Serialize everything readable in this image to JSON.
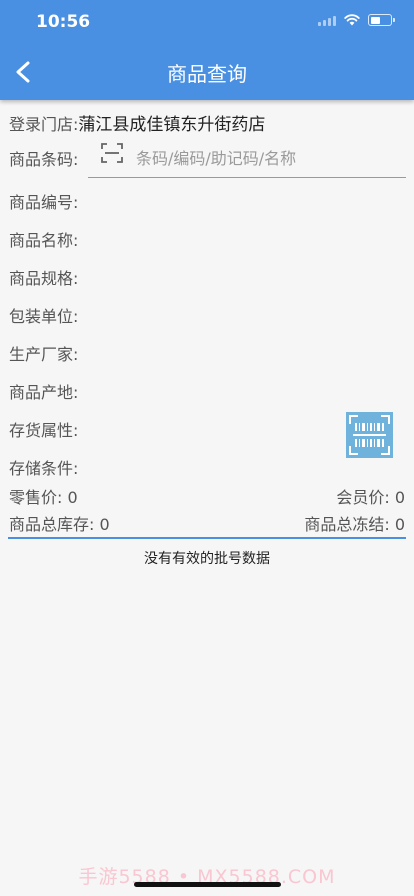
{
  "status_bar": {
    "time": "10:56"
  },
  "header": {
    "title": "商品查询"
  },
  "store": {
    "label": "登录门店:",
    "value": "蒲江县成佳镇东升街药店"
  },
  "search": {
    "label": "商品条码:",
    "placeholder": "条码/编码/助记码/名称",
    "value": ""
  },
  "fields": {
    "code": "商品编号:",
    "name": "商品名称:",
    "spec": "商品规格:",
    "unit": "包装单位:",
    "maker": "生产厂家:",
    "origin": "商品产地:",
    "attr": "存货属性:",
    "storage": "存储条件:"
  },
  "prices": {
    "retail_label": "零售价:",
    "retail_value": "0",
    "member_label": "会员价:",
    "member_value": "0"
  },
  "stock": {
    "total_label": "商品总库存:",
    "total_value": "0",
    "frozen_label": "商品总冻结:",
    "frozen_value": "0"
  },
  "batch": {
    "empty_text": "没有有效的批号数据"
  },
  "watermark": {
    "text": "手游5588 • MX5588.COM"
  },
  "colors": {
    "primary": "#4a90e2",
    "barcode_button": "#6fb3dc"
  },
  "icons": {
    "back": "back-chevron-icon",
    "scan": "scan-frame-icon",
    "barcode": "barcode-scan-icon",
    "wifi": "wifi-icon",
    "battery": "battery-icon",
    "signal": "signal-icon"
  }
}
